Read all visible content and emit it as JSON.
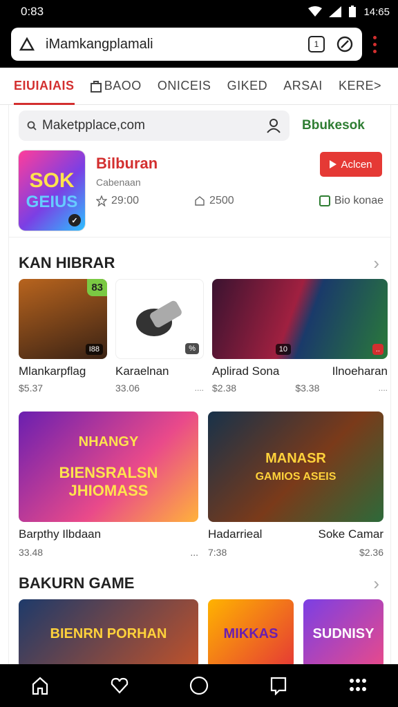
{
  "status": {
    "time": "0:83",
    "clock_right": "14:65"
  },
  "browser": {
    "url": "iMamkangplamali",
    "url_icon_tabs": "1"
  },
  "tabs": [
    {
      "label": "EIUIAIAIS",
      "active": true
    },
    {
      "label": "BAOO",
      "active": false
    },
    {
      "label": "ONICEIS",
      "active": false
    },
    {
      "label": "GIKED",
      "active": false
    },
    {
      "label": "ARSAI",
      "active": false
    },
    {
      "label": "KERE>",
      "active": false
    }
  ],
  "search": {
    "placeholder": "Maketpplace,com",
    "brand_link": "Bbukesok"
  },
  "featured": {
    "thumb_line1": "SOK",
    "thumb_line2": "GEIUS",
    "title": "Bilburan",
    "subtitle": "Cabenaan",
    "stat1": "29:00",
    "stat2": "2500",
    "install_label": "Aclcen",
    "right_label": "Bio konae"
  },
  "section1": {
    "title": "KAN HIBRAR"
  },
  "row4": [
    {
      "name": "Mlankarpflag",
      "price": "$5.37",
      "badge": "I88",
      "corner": "83"
    },
    {
      "name": "Karaelnan",
      "price": "33.06",
      "badge": "%",
      "extra": "...."
    },
    {
      "name": "Aplirad Sona",
      "price": "$2.38",
      "badge": "10"
    },
    {
      "name": "Ilnoeharan",
      "price": "$3.38",
      "badge": "..",
      "extra": "...."
    }
  ],
  "row2": [
    {
      "name_left": "Barpthy Ilbdaan",
      "price_left": "33.48",
      "extra": "...",
      "line1": "NHANGY",
      "line2": "BIENSRALSN",
      "line3": "JHIOMASS"
    },
    {
      "name_left": "Hadarrieal",
      "name_right": "Soke Camar",
      "price_left": "7:38",
      "price_right": "$2.36",
      "line1": "MANASR",
      "line2": "GAMIOS ASEIS"
    }
  ],
  "section2": {
    "title": "BAKURN GAME"
  },
  "row3": [
    {
      "label": "BIENRN PORHAN"
    },
    {
      "label": "MIKKAS"
    },
    {
      "label": "SUDNISY"
    }
  ]
}
